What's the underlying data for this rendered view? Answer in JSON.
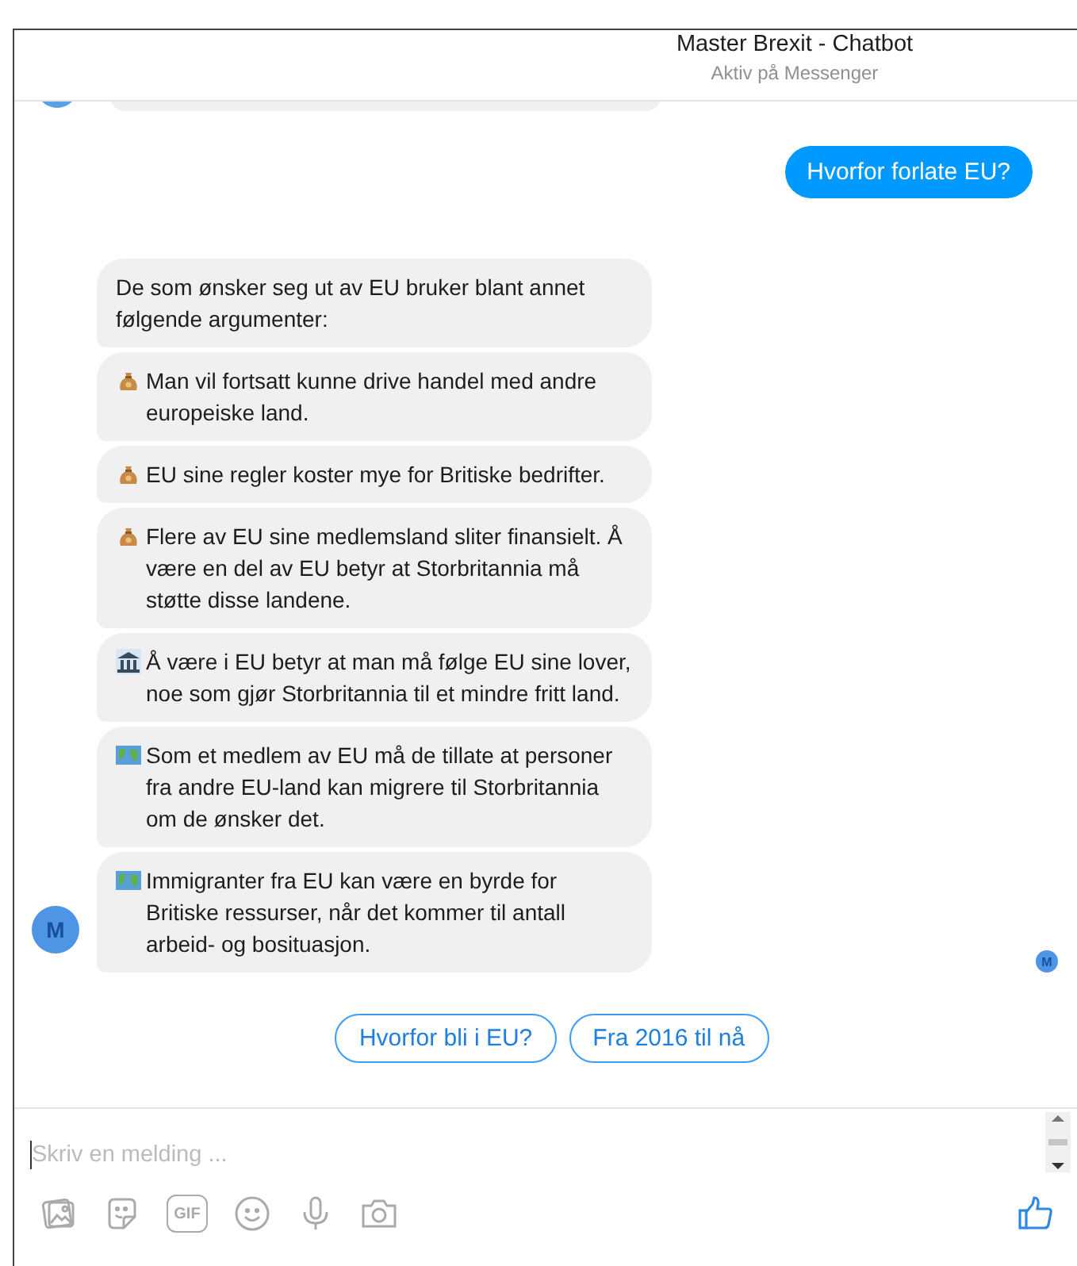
{
  "header": {
    "title": "Master Brexit - Chatbot",
    "subtitle": "Aktiv på Messenger"
  },
  "sent": {
    "text": "Hvorfor forlate EU?"
  },
  "bot": {
    "avatar": "M",
    "messages": [
      {
        "kind": "plain",
        "text": "De som ønsker seg ut av EU bruker blant annet følgende argumenter:"
      },
      {
        "kind": "money",
        "text": "Man vil fortsatt kunne drive handel med andre europeiske land."
      },
      {
        "kind": "money",
        "text": "EU sine regler koster mye for Britiske bedrifter."
      },
      {
        "kind": "money",
        "text": "Flere av EU sine medlemsland sliter finansielt. Å være en del av EU betyr at Storbritannia må støtte disse landene."
      },
      {
        "kind": "bank",
        "text": "Å være i EU betyr at man må følge EU sine lover, noe som gjør Storbritannia til et mindre fritt land."
      },
      {
        "kind": "map",
        "text": "Som et medlem av EU må de tillate at personer fra andre EU-land kan migrere til Storbritannia om de ønsker det."
      },
      {
        "kind": "map",
        "text": "Immigranter fra EU kan være en byrde for Britiske ressurser, når det kommer til antall arbeid- og bosituasjon."
      }
    ]
  },
  "seen_avatar": "M",
  "quick_replies": [
    "Hvorfor bli i EU?",
    "Fra 2016 til nå"
  ],
  "composer": {
    "placeholder": "Skriv en melding ..."
  },
  "toolbar": [
    {
      "kind": "photo"
    },
    {
      "kind": "sticker"
    },
    {
      "kind": "gif",
      "label": "GIF"
    },
    {
      "kind": "emoji"
    },
    {
      "kind": "mic"
    },
    {
      "kind": "camera"
    }
  ]
}
